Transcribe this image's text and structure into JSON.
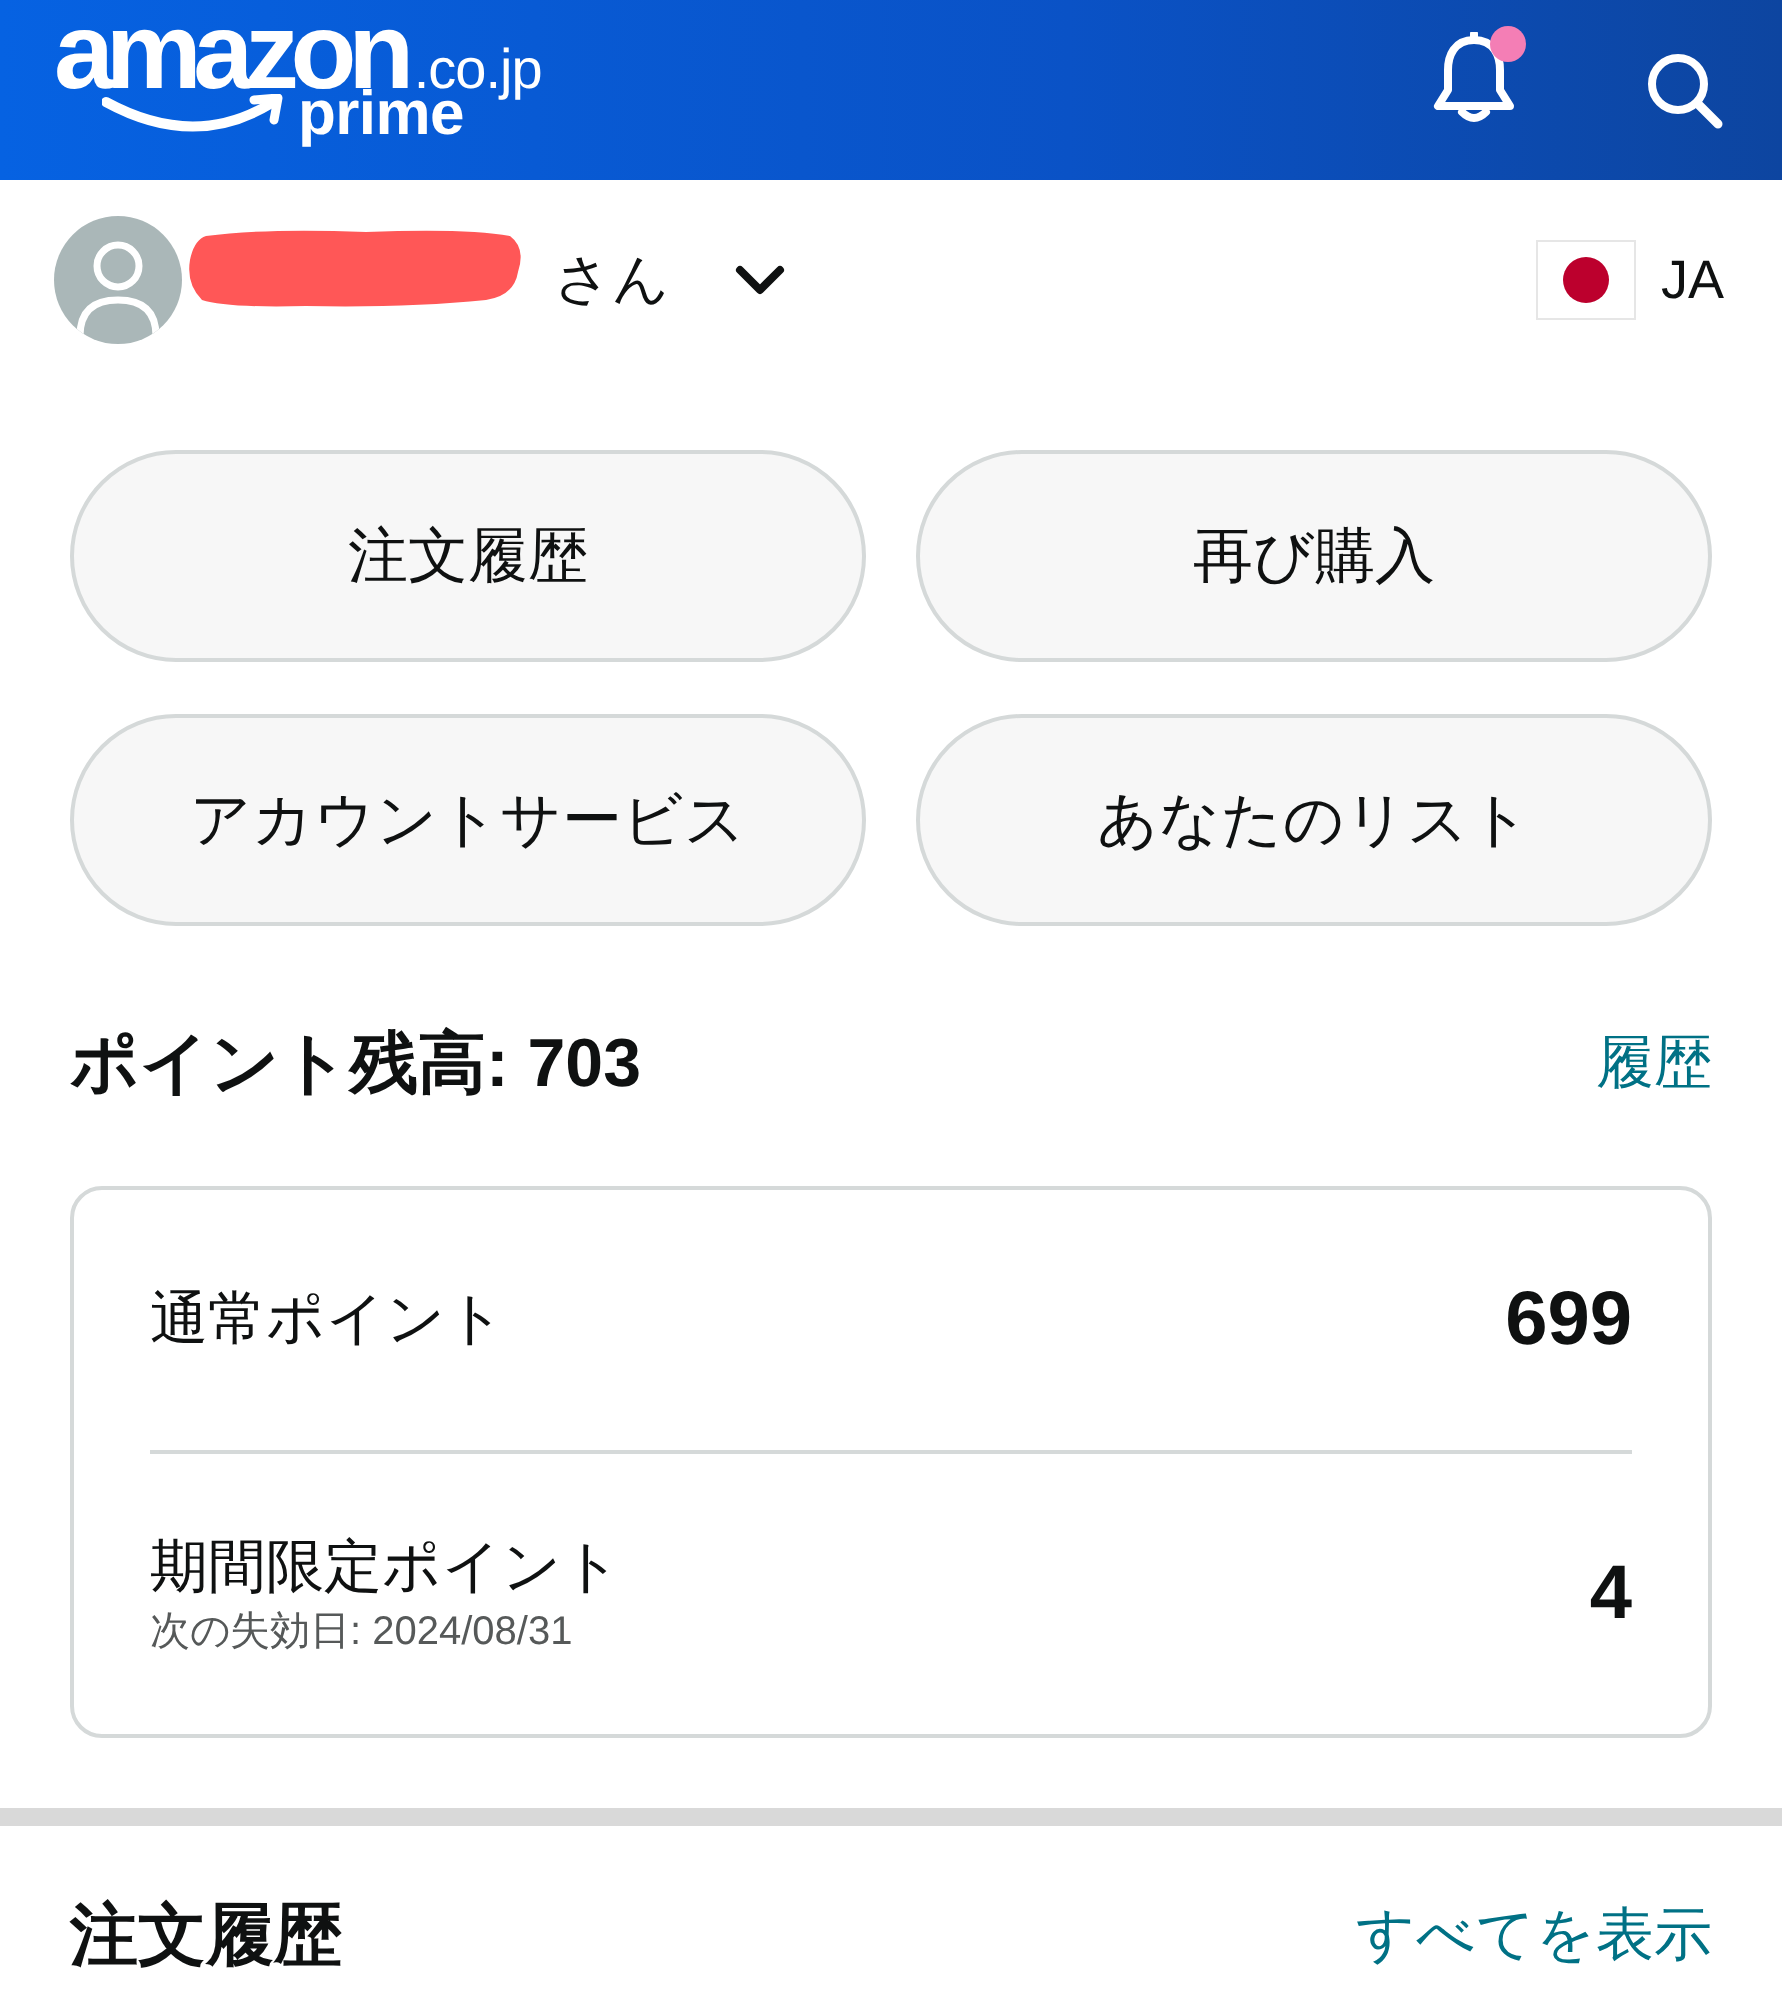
{
  "header": {
    "logo": {
      "wordmark": "amazon",
      "domain": ".co.jp",
      "program": "prime"
    },
    "has_notification": true
  },
  "account": {
    "name_redacted": true,
    "honorific": "さん",
    "language": "JA"
  },
  "quick_links": [
    {
      "label": "注文履歴"
    },
    {
      "label": "再び購入"
    },
    {
      "label": "アカウントサービス"
    },
    {
      "label": "あなたのリスト"
    }
  ],
  "points": {
    "title": "ポイント残高: 703",
    "history_link": "履歴",
    "rows": [
      {
        "label": "通常ポイント",
        "value": "699"
      },
      {
        "label": "期間限定ポイント",
        "note": "次の失効日: 2024/08/31",
        "value": "4"
      }
    ]
  },
  "orders": {
    "title": "注文履歴",
    "link": "すべてを表示"
  }
}
